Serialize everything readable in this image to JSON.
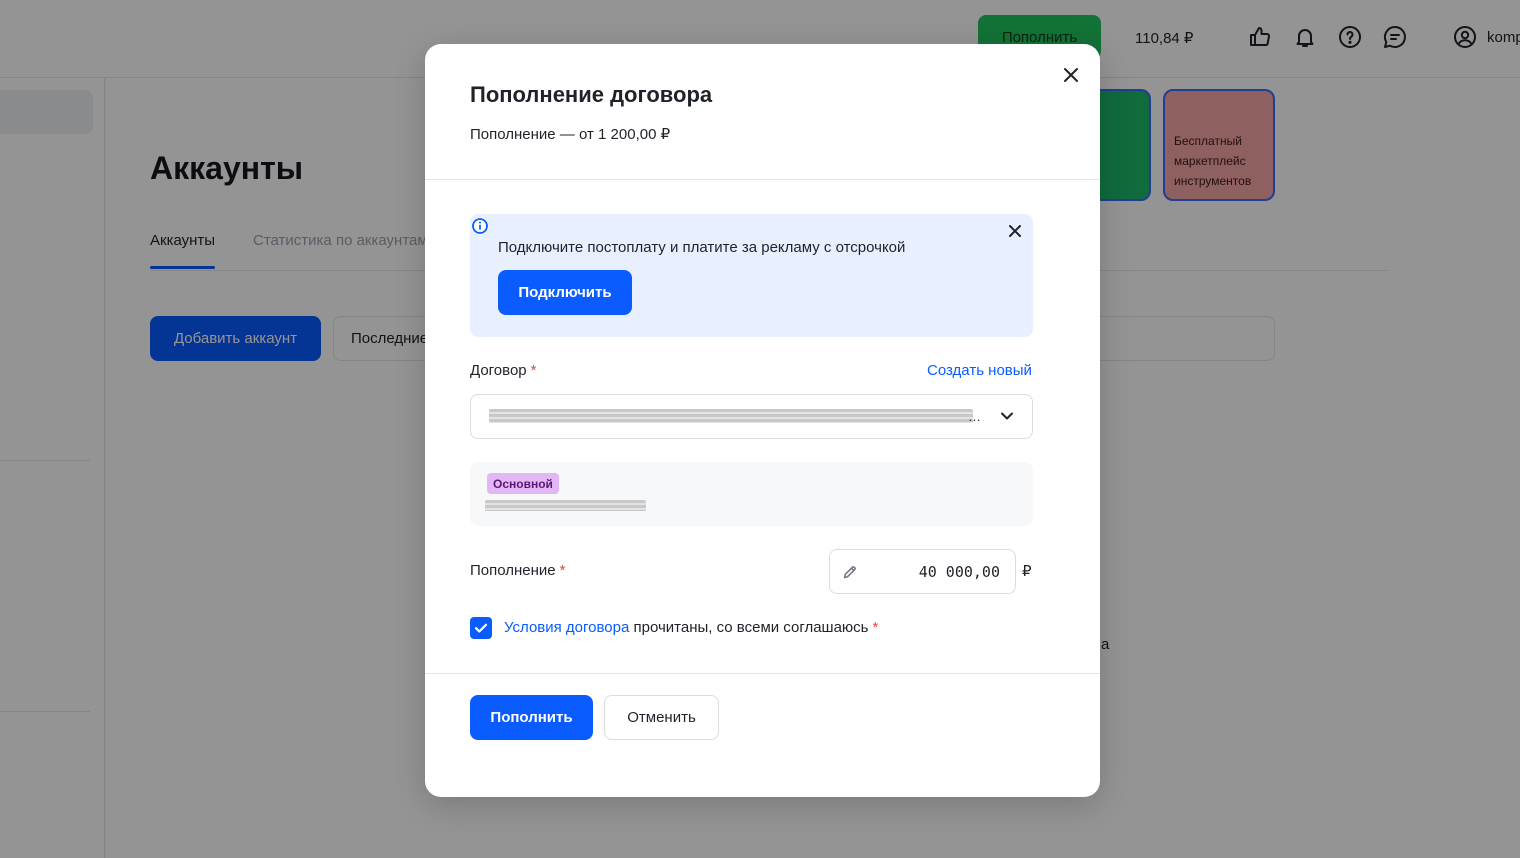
{
  "app": {
    "topbar": {
      "topup_label": "Пополнить",
      "balance": "110,84 ₽",
      "user_label": "komp",
      "icons": [
        "thumbs-up-icon",
        "bell-icon",
        "help-icon",
        "chat-icon",
        "user-icon"
      ]
    },
    "page": {
      "title": "Аккаунты",
      "tabs": [
        {
          "label": "Аккаунты",
          "active": true
        },
        {
          "label": "Статистика по аккаунтам",
          "active": false
        }
      ],
      "add_button": "Добавить аккаунт",
      "filter_value": "Последние",
      "promo_text": "Бесплатный маркетплейс инструментов",
      "partial_char": "а"
    }
  },
  "modal": {
    "title": "Пополнение договора",
    "subtitle": "Пополнение — от 1 200,00 ₽",
    "banner": {
      "text": "Подключите постоплату и платите за рекламу с отсрочкой",
      "button": "Подключить"
    },
    "contract": {
      "label": "Договор",
      "required_mark": "*",
      "create_link": "Создать новый",
      "selected_ellipsis": "…",
      "badge": "Основной"
    },
    "amount": {
      "label": "Пополнение",
      "required_mark": "*",
      "value": "40 000,00",
      "currency": "₽"
    },
    "agreement": {
      "checked": true,
      "link_text": "Условия договора",
      "rest_text": " прочитаны, со всеми соглашаюсь",
      "required_mark": "*"
    },
    "actions": {
      "submit": "Пополнить",
      "cancel": "Отменить"
    }
  },
  "colors": {
    "accent": "#0a5cff",
    "required": "#e5483d",
    "banner_bg": "#e8efff",
    "badge_bg": "#e3b7f5",
    "badge_text": "#5b1778",
    "overlay": "rgba(0,0,0,0.42)"
  }
}
